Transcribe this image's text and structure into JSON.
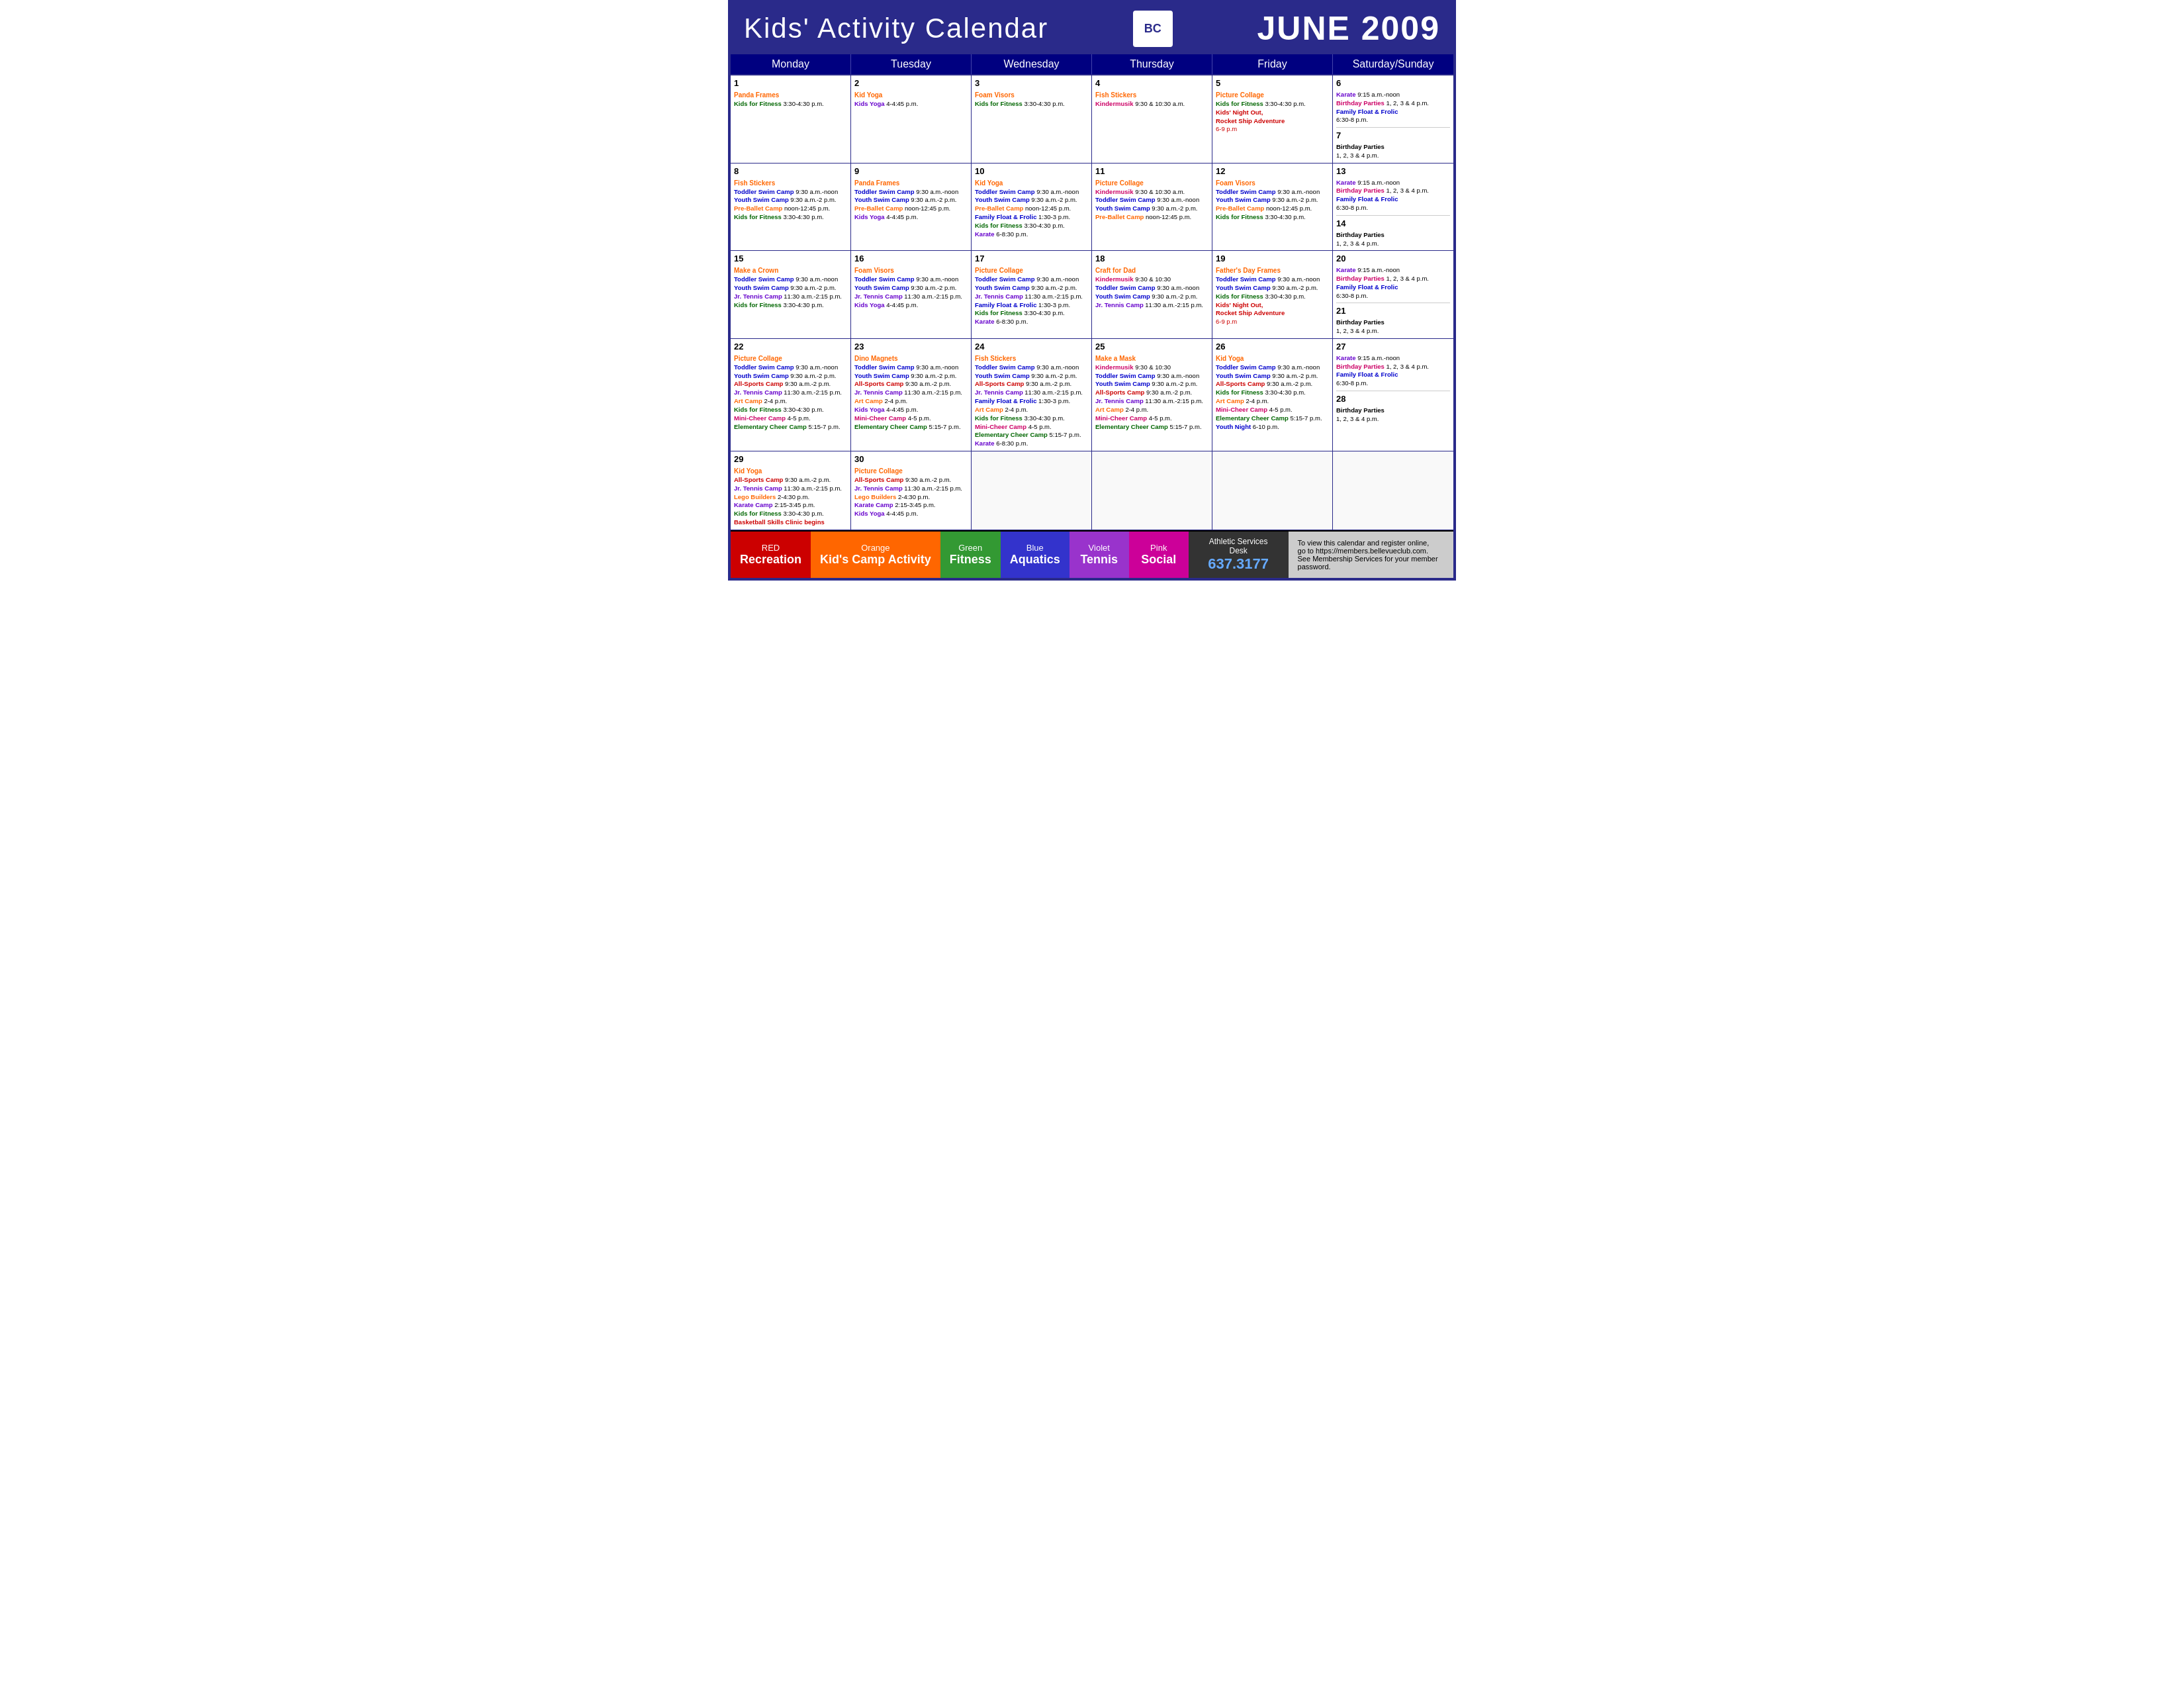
{
  "header": {
    "title": "Kids' Activity Calendar",
    "month": "JUNE 2009",
    "logo": "BC"
  },
  "days": [
    "Monday",
    "Tuesday",
    "Wednesday",
    "Thursday",
    "Friday",
    "Saturday/Sunday"
  ],
  "footer": {
    "legend": [
      {
        "label_top": "RED",
        "label_bottom": "Recreation",
        "color": "leg-red"
      },
      {
        "label_top": "Orange",
        "label_bottom": "Kid's Camp Activity",
        "color": "leg-orange"
      },
      {
        "label_top": "Green",
        "label_bottom": "Fitness",
        "color": "leg-green"
      },
      {
        "label_top": "Blue",
        "label_bottom": "Aquatics",
        "color": "leg-blue"
      },
      {
        "label_top": "Violet",
        "label_bottom": "Tennis",
        "color": "leg-violet"
      },
      {
        "label_top": "Pink",
        "label_bottom": "Social",
        "color": "leg-pink"
      }
    ],
    "desk_label": "Athletic Services Desk",
    "phone": "637.3177",
    "info_line1": "To view this calendar and register online,",
    "info_line2": "go to https://members.bellevueclub.com.",
    "info_line3": "See Membership Services for your member password."
  }
}
